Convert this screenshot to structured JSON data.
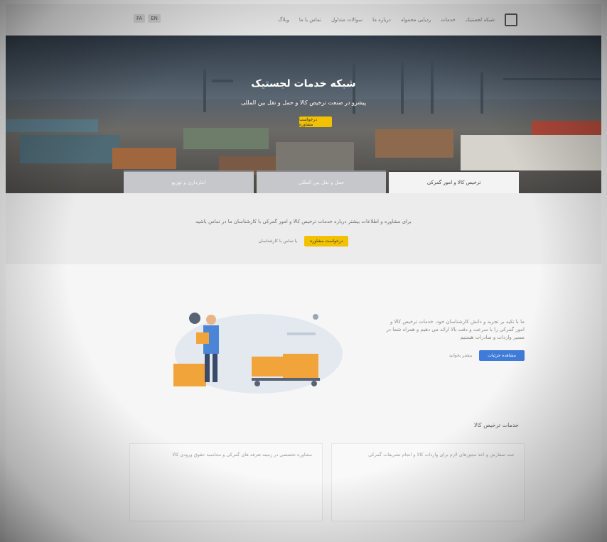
{
  "nav": {
    "items": [
      "شبکه لجستیک",
      "خدمات",
      "ردیابی محموله",
      "درباره ما",
      "سوالات متداول",
      "تماس با ما",
      "وبلاگ"
    ],
    "lang": [
      "EN",
      "FA"
    ]
  },
  "hero": {
    "title": "شبکه خدمات لجستیک",
    "subtitle": "پیشرو در صنعت ترخیص کالا و حمل و نقل بین المللی",
    "cta": "درخواست مشاوره"
  },
  "tabs": [
    "ترخیص کالا و امور گمرکی",
    "حمل و نقل بین المللی",
    "انبارداری و توزیع"
  ],
  "band": {
    "text": "برای مشاوره و اطلاعات بیشتر درباره خدمات ترخیص کالا و امور گمرکی با کارشناسان ما در تماس باشید",
    "button": "درخواست مشاوره",
    "link": "یا تماس با کارشناسان"
  },
  "feature": {
    "description": "ما با تکیه بر تجربه و دانش کارشناسان خود، خدمات ترخیص کالا و امور گمرکی را با سرعت و دقت بالا ارائه می دهیم و همراه شما در مسیر واردات و صادرات هستیم",
    "primary_button": "مشاهده جزئیات",
    "secondary_link": "بیشتر بخوانید"
  },
  "section": {
    "title": "خدمات ترخیص کالا"
  },
  "cards": [
    "ثبت سفارش و اخذ مجوزهای لازم برای واردات کالا و انجام تشریفات گمرکی",
    "مشاوره تخصصی در زمینه تعرفه های گمرکی و محاسبه حقوق ورودی کالا"
  ],
  "colors": {
    "accent_yellow": "#f2c200",
    "accent_blue": "#3f7bd9"
  }
}
